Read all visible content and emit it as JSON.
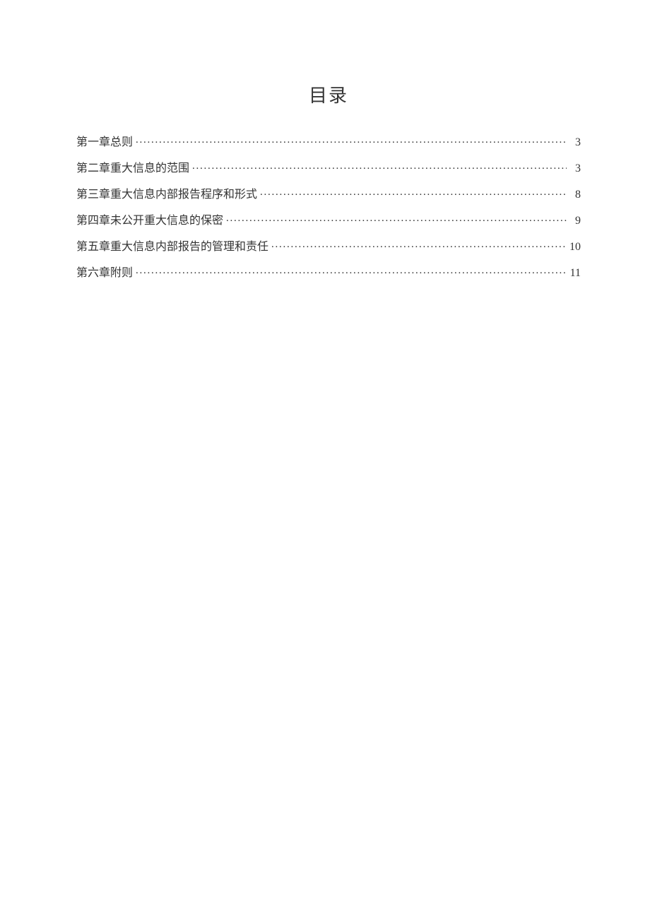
{
  "title": "目录",
  "toc": [
    {
      "label": "第一章总则",
      "page": "3"
    },
    {
      "label": "第二章重大信息的范围",
      "page": "3"
    },
    {
      "label": "第三章重大信息内部报告程序和形式",
      "page": "8"
    },
    {
      "label": "第四章未公开重大信息的保密",
      "page": "9"
    },
    {
      "label": "第五章重大信息内部报告的管理和责任",
      "page": "10"
    },
    {
      "label": "第六章附则",
      "page": "11"
    }
  ]
}
